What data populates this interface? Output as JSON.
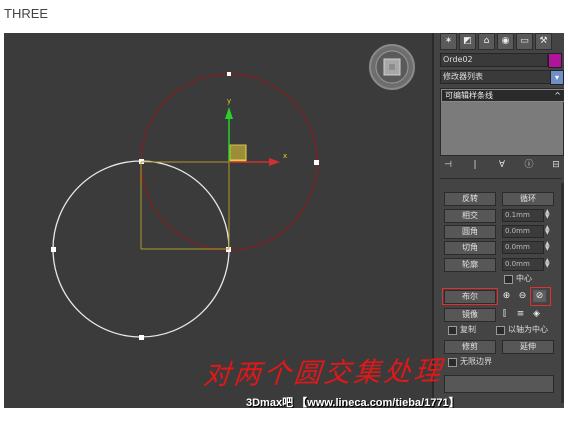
{
  "page": {
    "heading": "THREE"
  },
  "panel": {
    "object_name": "Orde02",
    "object_color": "#b0149a",
    "modifier_list_label": "修改器列表",
    "stack_item": "可编辑样条线",
    "stack_arrow": "^",
    "tab_icons": [
      "✶",
      "◩",
      "⌂",
      "◉",
      "▭",
      "⚒"
    ],
    "tool_icons": [
      "⊣",
      "|",
      "∀",
      "ⓘ",
      "⊟"
    ],
    "rows": {
      "reverse": "反转",
      "cycle": "循环",
      "intersect": "相交",
      "intersect_value": "0.1mm",
      "fillet": "圆角",
      "fillet_value": "0.0mm",
      "chamfer": "切角",
      "chamfer_value": "0.0mm",
      "outline": "轮廓",
      "outline_value": "0.0mm",
      "center": "中心",
      "boolean": "布尔",
      "mirror": "镜像",
      "copy": "复制",
      "about_pivot": "以轴为中心",
      "trim": "修剪",
      "extend": "延伸",
      "infinite_bounds": "无限边界"
    }
  },
  "viewport": {
    "axis_x": "x",
    "axis_y": "y",
    "colors": {
      "white_circle": "#e8e8e8",
      "red_circle": "#8a1d1d",
      "bbox": "#b09a2a",
      "axis_y": "#2bd12b",
      "axis_x": "#d23030"
    }
  },
  "overlay": {
    "handwriting": "对两个圆交集处理",
    "watermark": "3Dmax吧 【www.lineca.com/tieba/1771】"
  }
}
